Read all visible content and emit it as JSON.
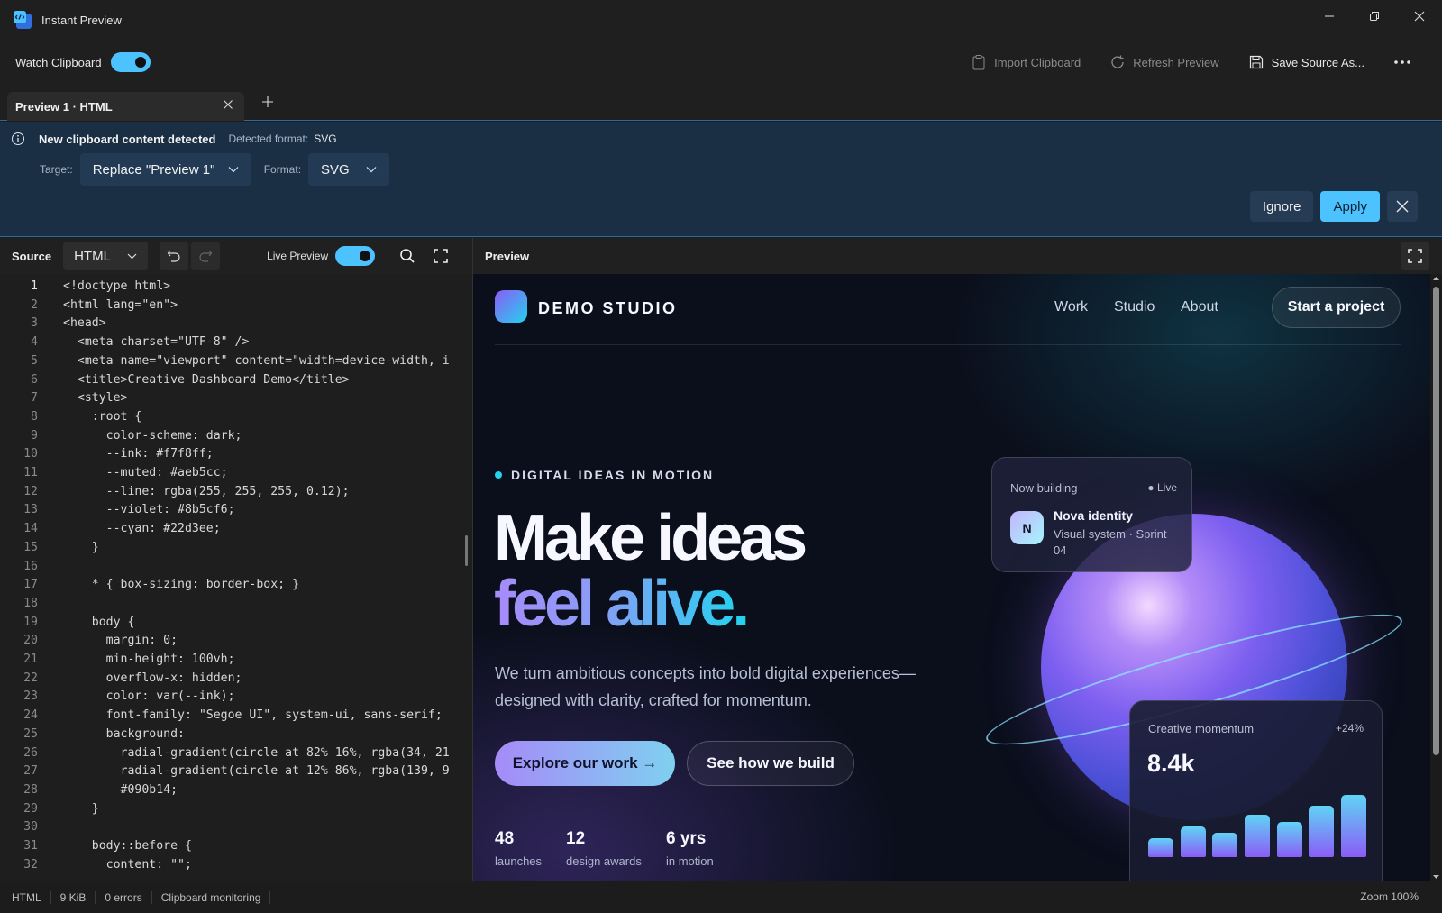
{
  "window": {
    "title": "Instant Preview"
  },
  "toolbar": {
    "watch_label": "Watch Clipboard",
    "watch_on": true,
    "import_label": "Import Clipboard",
    "refresh_label": "Refresh Preview",
    "save_label": "Save Source As..."
  },
  "tabs": [
    {
      "label": "Preview 1 · HTML"
    }
  ],
  "infobar": {
    "title": "New clipboard content detected",
    "detected_label": "Detected format:",
    "detected_value": "SVG",
    "target_label": "Target:",
    "target_value": "Replace \"Preview 1\"",
    "format_label": "Format:",
    "format_value": "SVG",
    "ignore_label": "Ignore",
    "apply_label": "Apply",
    "accent": "#4cc2ff"
  },
  "source": {
    "title": "Source",
    "language": "HTML",
    "live_label": "Live Preview",
    "live_on": true,
    "current_line": 1,
    "lines": [
      "<!doctype html>",
      "<html lang=\"en\">",
      "<head>",
      "  <meta charset=\"UTF-8\" />",
      "  <meta name=\"viewport\" content=\"width=device-width, i",
      "  <title>Creative Dashboard Demo</title>",
      "  <style>",
      "    :root {",
      "      color-scheme: dark;",
      "      --ink: #f7f8ff;",
      "      --muted: #aeb5cc;",
      "      --line: rgba(255, 255, 255, 0.12);",
      "      --violet: #8b5cf6;",
      "      --cyan: #22d3ee;",
      "    }",
      "",
      "    * { box-sizing: border-box; }",
      "",
      "    body {",
      "      margin: 0;",
      "      min-height: 100vh;",
      "      overflow-x: hidden;",
      "      color: var(--ink);",
      "      font-family: \"Segoe UI\", system-ui, sans-serif;",
      "      background:",
      "        radial-gradient(circle at 82% 16%, rgba(34, 21",
      "        radial-gradient(circle at 12% 86%, rgba(139, 9",
      "        #090b14;",
      "    }",
      "",
      "    body::before {",
      "      content: \"\";"
    ]
  },
  "preview": {
    "title": "Preview",
    "site": {
      "brand": "DEMO STUDIO",
      "nav": [
        "Work",
        "Studio",
        "About"
      ],
      "cta": "Start a project",
      "eyebrow": "DIGITAL IDEAS IN MOTION",
      "headline_1": "Make ideas",
      "headline_2": "feel alive.",
      "lead": "We turn ambitious concepts into bold digital experiences—designed with clarity, crafted for momentum.",
      "btn_primary": "Explore our work →",
      "btn_secondary": "See how we build",
      "stats": [
        {
          "value": "48",
          "label": "launches"
        },
        {
          "value": "12",
          "label": "design awards"
        },
        {
          "value": "6 yrs",
          "label": "in motion"
        }
      ],
      "now_building": {
        "label": "Now building",
        "status": "● Live",
        "avatar": "N",
        "name": "Nova identity",
        "desc": "Visual system · Sprint 04"
      },
      "momentum": {
        "label": "Creative momentum",
        "delta": "+24%",
        "value": "8.4k",
        "bars": [
          0.28,
          0.45,
          0.36,
          0.63,
          0.52,
          0.76,
          0.92
        ]
      }
    }
  },
  "statusbar": {
    "lang": "HTML",
    "size": "9 KiB",
    "errors": "0 errors",
    "monitor": "Clipboard monitoring",
    "zoom": "Zoom 100%"
  }
}
